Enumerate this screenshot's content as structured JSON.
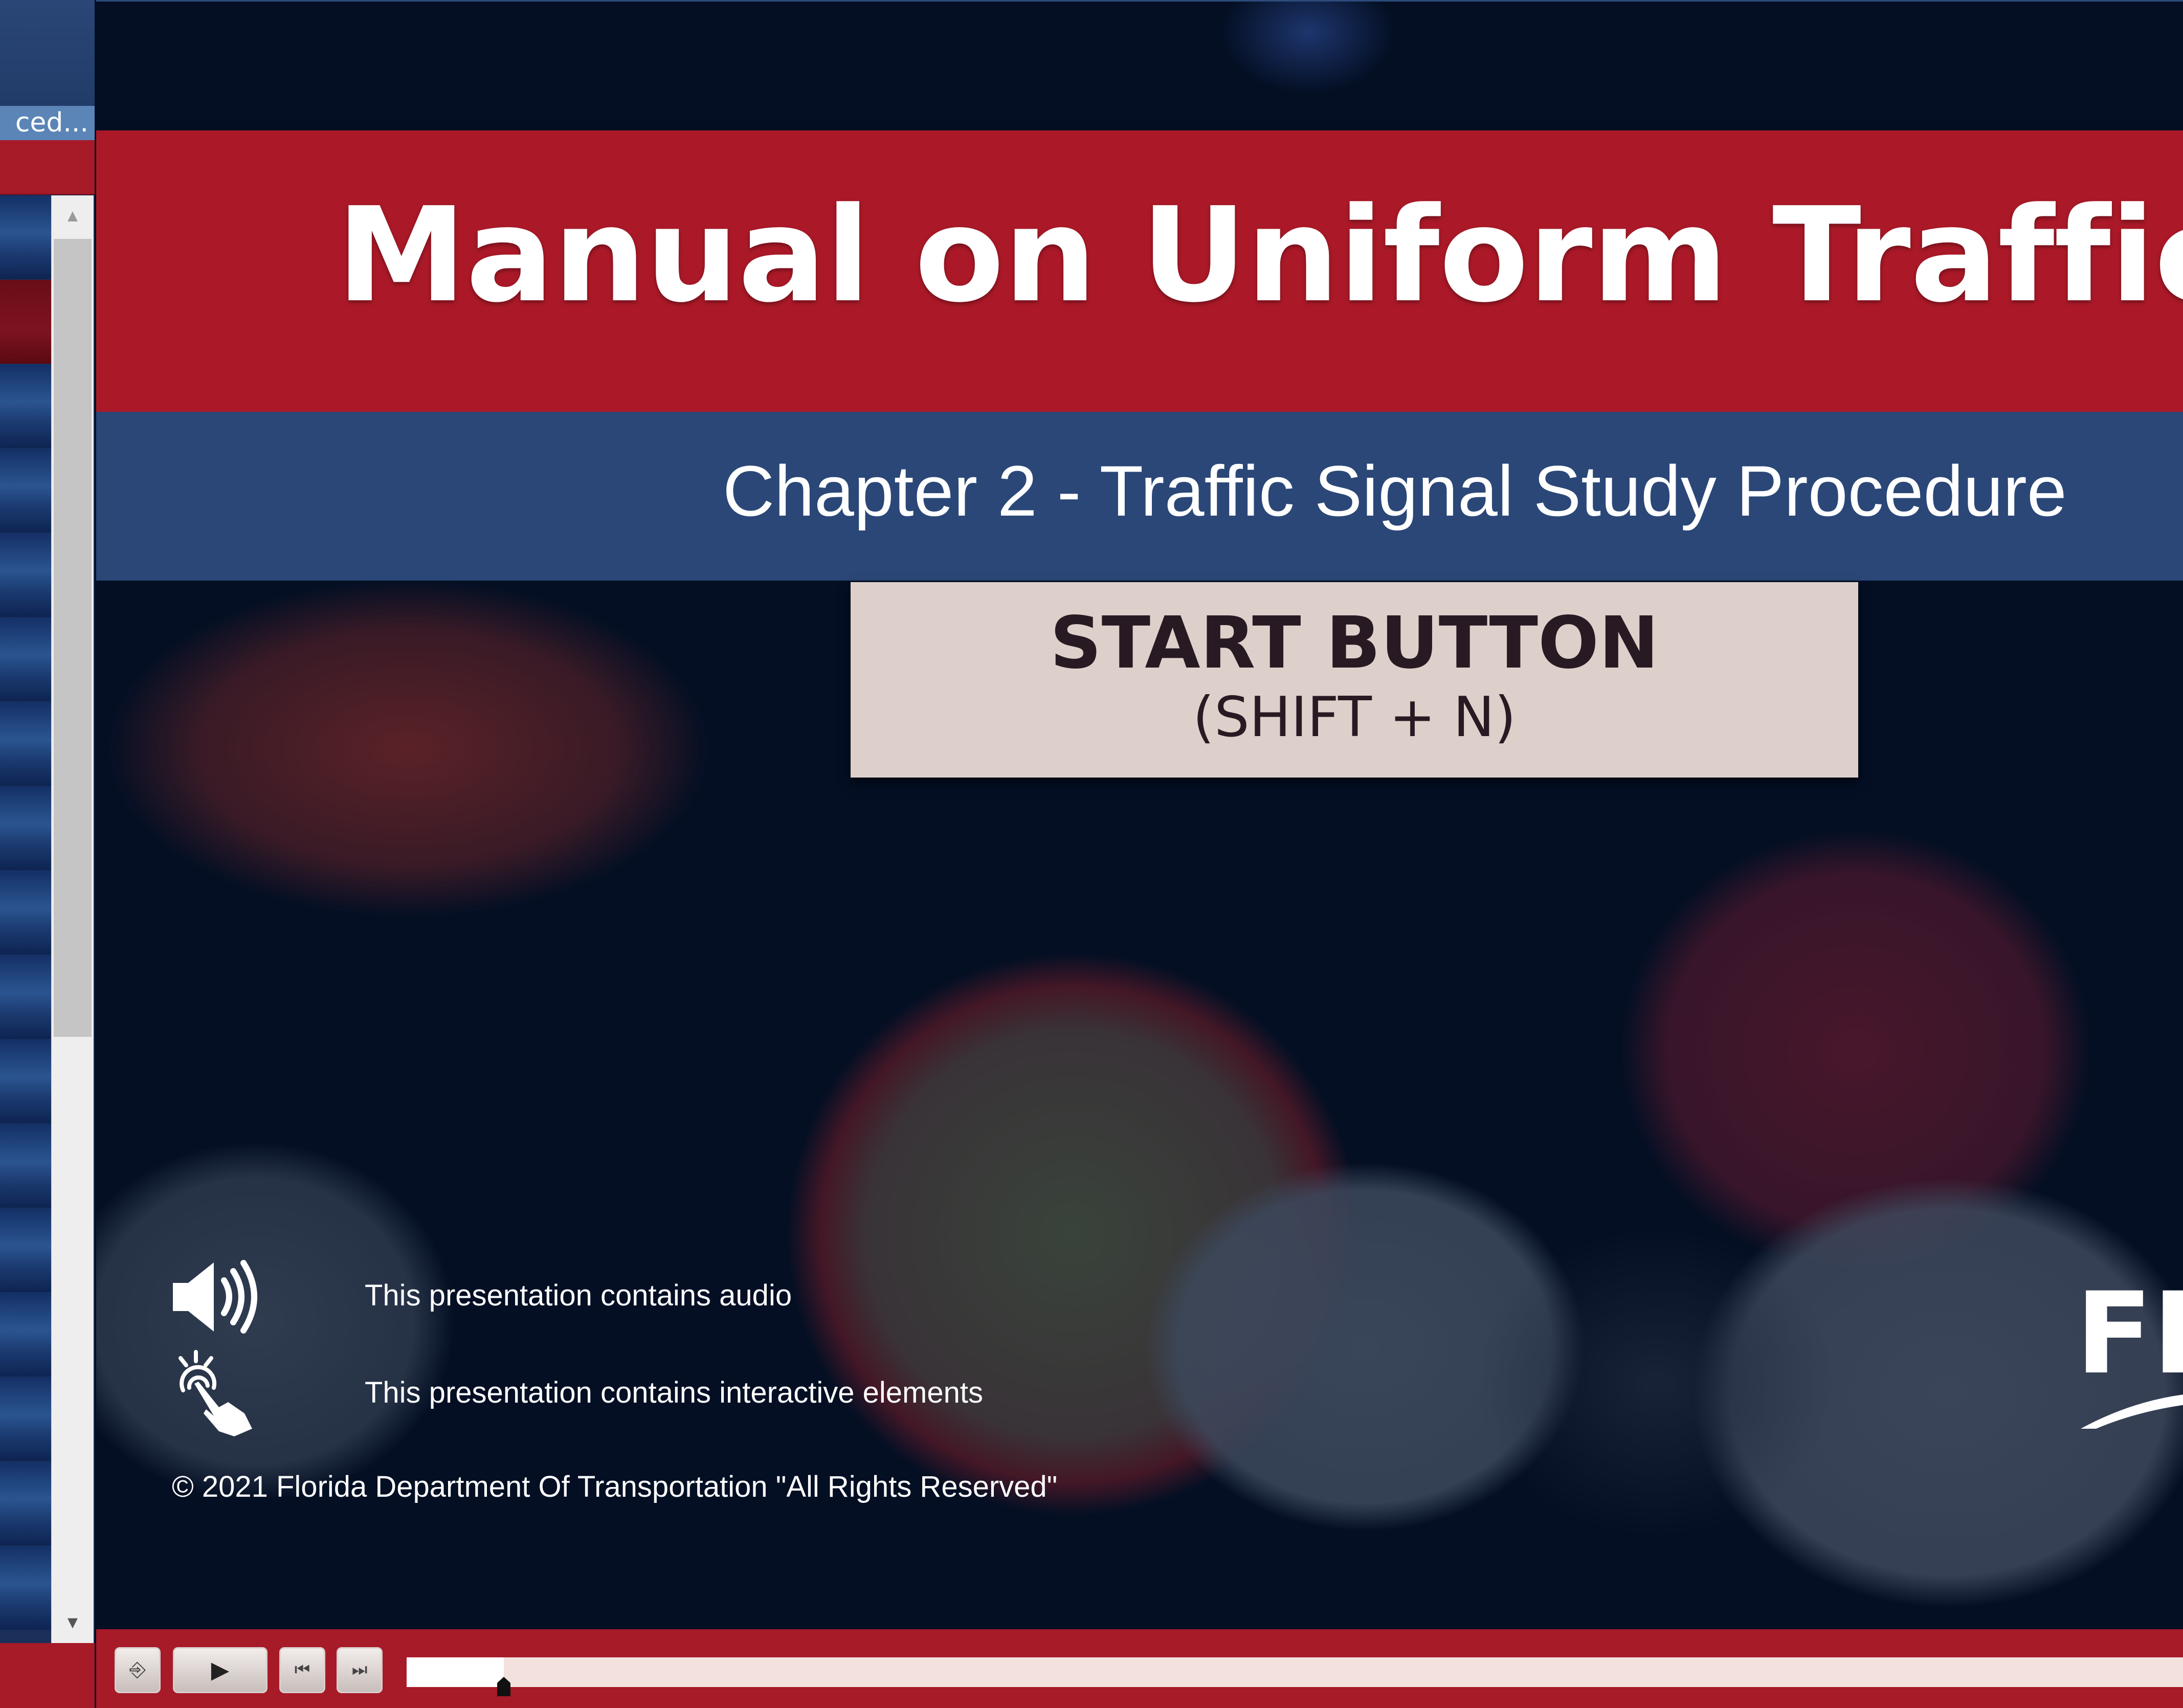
{
  "sidebar": {
    "title": "ced...",
    "outline_item_count": 17,
    "active_item_index": 1
  },
  "slide": {
    "title": "Manual on Uniform Traffic Stud",
    "subtitle": "Chapter 2 - Traffic Signal Study Procedure",
    "start_button": {
      "label": "START BUTTON",
      "shortcut": "(SHIFT + N)"
    },
    "notices": [
      {
        "icon": "speaker-icon",
        "text": "This presentation contains audio"
      },
      {
        "icon": "tap-hand-icon",
        "text": "This presentation contains interactive elements"
      }
    ],
    "copyright": "© 2021 Florida Department Of Transportation \"All Rights Reserved\"",
    "logo_text": "FD",
    "colors": {
      "title_band": "#ab1928",
      "subtitle_band": "#2a4777",
      "background": "#040f24",
      "start_button": "#ddd0cb"
    }
  },
  "player": {
    "buttons": [
      {
        "name": "exit-icon",
        "glyph": "⎆"
      },
      {
        "name": "play-icon",
        "glyph": "▶"
      },
      {
        "name": "previous-icon",
        "glyph": "⏮"
      },
      {
        "name": "next-icon",
        "glyph": "⏭"
      }
    ],
    "progress_fraction": 0.02,
    "colors": {
      "bar": "#a71a28",
      "track": "#f3e1dd"
    }
  }
}
